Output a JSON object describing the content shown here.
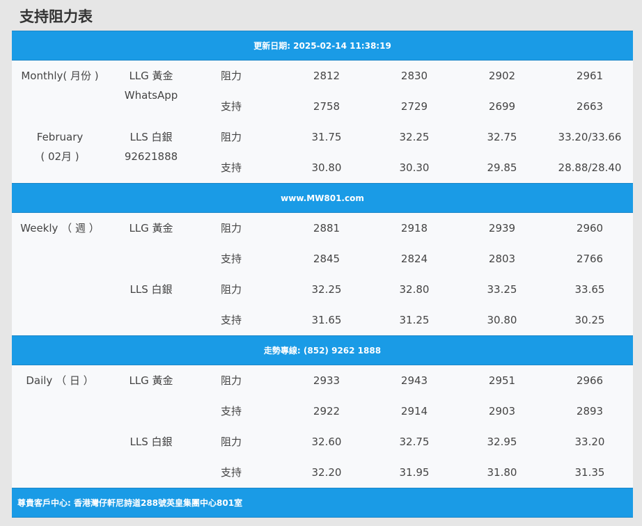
{
  "title": "支持阻力表",
  "header_bar": "更新日期: 2025-02-14 11:38:19",
  "bar_website": "www.MW801.com",
  "bar_hotline": "走勢專線: (852) 9262 1888",
  "footer_bar": "尊貴客戶中心: 香港灣仔軒尼詩道288號英皇集團中心801室",
  "monthly": {
    "period_line1": "Monthly( 月份 )",
    "period_line2": "February",
    "period_line3": "( 02月 )",
    "llg_label": "LLG 黃金",
    "whatsapp_label": "WhatsApp",
    "lls_label": "LLS 白銀",
    "phone": "92621888",
    "rows": [
      {
        "type": "阻力",
        "v": [
          "2812",
          "2830",
          "2902",
          "2961"
        ]
      },
      {
        "type": "支持",
        "v": [
          "2758",
          "2729",
          "2699",
          "2663"
        ]
      },
      {
        "type": "阻力",
        "v": [
          "31.75",
          "32.25",
          "32.75",
          "33.20/33.66"
        ]
      },
      {
        "type": "支持",
        "v": [
          "30.80",
          "30.30",
          "29.85",
          "28.88/28.40"
        ]
      }
    ]
  },
  "weekly": {
    "period": "Weekly （ 週 ）",
    "llg_label": "LLG 黃金",
    "lls_label": "LLS 白銀",
    "rows": [
      {
        "type": "阻力",
        "v": [
          "2881",
          "2918",
          "2939",
          "2960"
        ]
      },
      {
        "type": "支持",
        "v": [
          "2845",
          "2824",
          "2803",
          "2766"
        ]
      },
      {
        "type": "阻力",
        "v": [
          "32.25",
          "32.80",
          "33.25",
          "33.65"
        ]
      },
      {
        "type": "支持",
        "v": [
          "31.65",
          "31.25",
          "30.80",
          "30.25"
        ]
      }
    ]
  },
  "daily": {
    "period": "Daily （ 日 ）",
    "llg_label": "LLG 黃金",
    "lls_label": "LLS 白銀",
    "rows": [
      {
        "type": "阻力",
        "v": [
          "2933",
          "2943",
          "2951",
          "2966"
        ]
      },
      {
        "type": "支持",
        "v": [
          "2922",
          "2914",
          "2903",
          "2893"
        ]
      },
      {
        "type": "阻力",
        "v": [
          "32.60",
          "32.75",
          "32.95",
          "33.20"
        ]
      },
      {
        "type": "支持",
        "v": [
          "32.20",
          "31.95",
          "31.80",
          "31.35"
        ]
      }
    ]
  }
}
